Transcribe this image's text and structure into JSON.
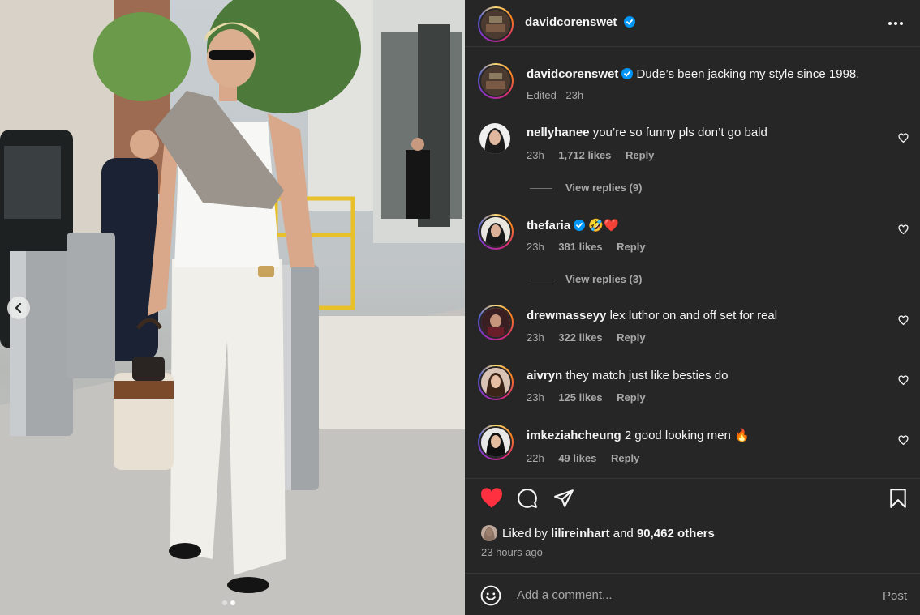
{
  "post": {
    "author": "davidcorenswet",
    "verified": true,
    "more_icon": "more-horizontal-icon"
  },
  "caption": {
    "username": "davidcorenswet",
    "text": "Dude’s been jacking my style since 1998.",
    "meta": "Edited · 23h"
  },
  "comments": [
    {
      "username": "nellyhanee",
      "verified": false,
      "text": "you’re so funny pls don’t go bald",
      "time": "23h",
      "likes": "1,712 likes",
      "reply": "Reply",
      "view_replies": "View replies (9)"
    },
    {
      "username": "thefaria",
      "verified": true,
      "text": "🤣❤️",
      "time": "23h",
      "likes": "381 likes",
      "reply": "Reply",
      "view_replies": "View replies (3)"
    },
    {
      "username": "drewmasseyy",
      "verified": false,
      "text": "lex luthor on and off set for real",
      "time": "23h",
      "likes": "322 likes",
      "reply": "Reply"
    },
    {
      "username": "aivryn",
      "verified": false,
      "text": "they match just like besties do",
      "time": "23h",
      "likes": "125 likes",
      "reply": "Reply"
    },
    {
      "username": "imkeziahcheung",
      "verified": false,
      "text": "2 good looking men 🔥",
      "time": "22h",
      "likes": "49 likes",
      "reply": "Reply"
    }
  ],
  "liked_by": {
    "prefix": "Liked by",
    "user": "lilireinhart",
    "connector": "and",
    "others": "90,462 others"
  },
  "time_ago": "23 hours ago",
  "comment_box": {
    "placeholder": "Add a comment...",
    "post_label": "Post"
  },
  "carousel": {
    "total": 2,
    "active": 2
  },
  "colors": {
    "panel_bg": "#262626",
    "like_red": "#ff3040",
    "verified_blue": "#0095f6",
    "muted": "#a8a8a8"
  }
}
